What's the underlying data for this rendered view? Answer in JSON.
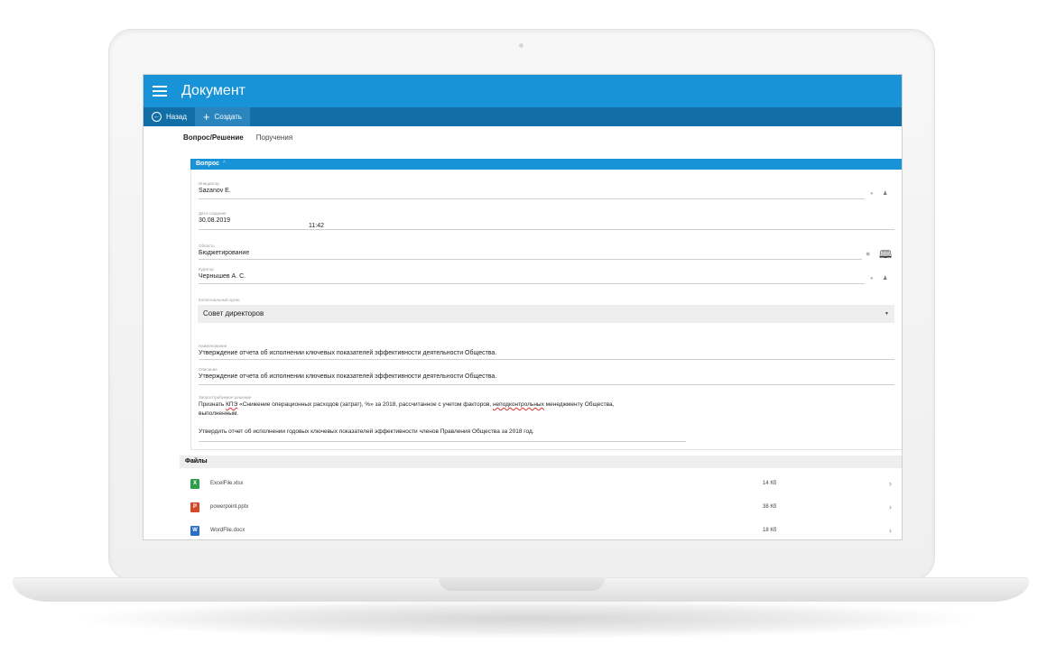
{
  "app": {
    "title": "Документ"
  },
  "toolbar": {
    "back_label": "Назад",
    "create_label": "Создать"
  },
  "tabs": [
    {
      "label": "Вопрос/Решение",
      "active": true
    },
    {
      "label": "Поручения",
      "active": false
    }
  ],
  "section": {
    "title": "Вопрос",
    "caret": "^"
  },
  "fields": {
    "initiator": {
      "label": "Инициатор",
      "value": "Sazanov E."
    },
    "created": {
      "label": "Дата создания",
      "date": "30.08.2019",
      "time": "11:42"
    },
    "area": {
      "label": "Область",
      "value": "Бюджетирование"
    },
    "curator": {
      "label": "Куратор",
      "value": "Чернышев А. С."
    },
    "body": {
      "label": "Коллегиальный орган",
      "value": "Совет директоров"
    },
    "name": {
      "label": "Наименование",
      "value": "Утверждение отчета об исполнении ключевых показателей эффективности деятельности Общества."
    },
    "description": {
      "label": "Описание",
      "value": "Утверждение отчета об исполнении ключевых показателей эффективности деятельности Общества."
    },
    "decision": {
      "label": "Запрос/требуемое решение",
      "line1_a": "Признать ",
      "line1_kpe": "КПЭ",
      "line1_b": " «Снижение операционных расходов (затрат), %» за 2018, рассчитанное с учетом факторов, ",
      "line1_spell": "неподконтрольных",
      "line1_c": " менеджменту Общества,",
      "line2": "выполненным.",
      "line3": "Утвердить отчет об исполнении годовых ключевых показателей эффективности членов Правления Общества за 2018 год."
    }
  },
  "files": {
    "title": "Файлы",
    "items": [
      {
        "name": "ExcelFile.xlsx",
        "size": "14 Кб",
        "badge": "X",
        "color": "#2e9e4c"
      },
      {
        "name": "powerpoint.pptx",
        "size": "38 Кб",
        "badge": "P",
        "color": "#d6492c"
      },
      {
        "name": "WordFile.docx",
        "size": "18 Кб",
        "badge": "W",
        "color": "#2b6cc4"
      }
    ]
  },
  "colors": {
    "accent": "#1993d8",
    "toolbar": "#126ea6"
  }
}
